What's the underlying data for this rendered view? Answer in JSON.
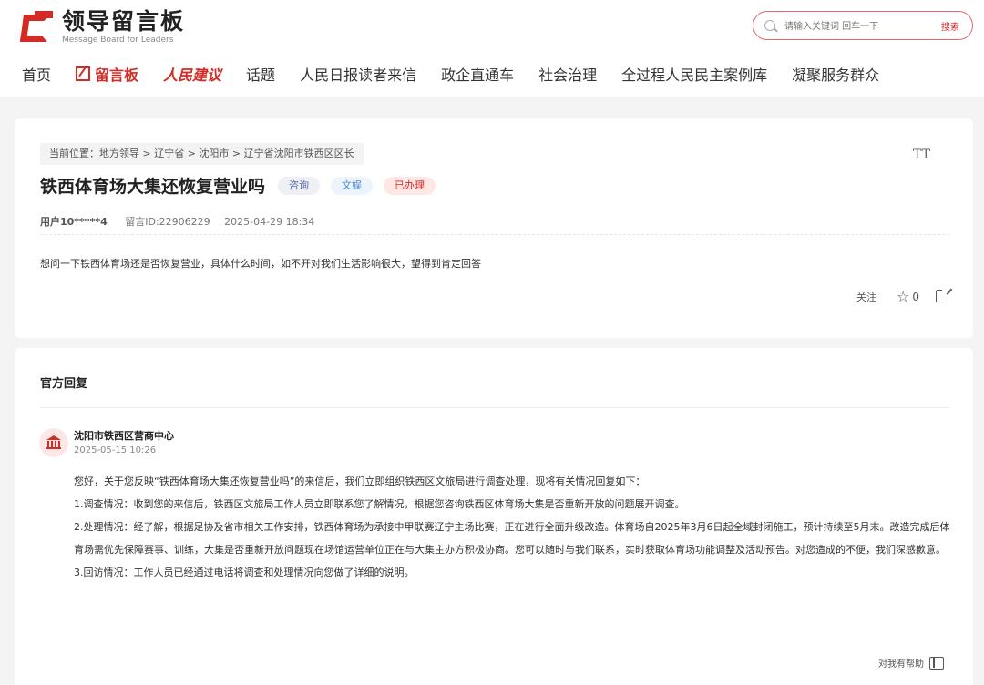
{
  "header": {
    "logo_title": "领导留言板",
    "logo_subtitle": "Message Board for Leaders",
    "search": {
      "placeholder": "请输入关键词 回车一下",
      "button": "搜索"
    }
  },
  "nav": [
    {
      "label": "首页"
    },
    {
      "label": "留言板"
    },
    {
      "label": "人民建议"
    },
    {
      "label": "话题"
    },
    {
      "label": "人民日报读者来信"
    },
    {
      "label": "政企直通车"
    },
    {
      "label": "社会治理"
    },
    {
      "label": "全过程人民民主案例库"
    },
    {
      "label": "凝聚服务群众"
    }
  ],
  "message": {
    "breadcrumb": "当前位置：地方领导 > 辽宁省 > 沈阳市 > 辽宁省沈阳市铁西区区长",
    "font_toggle": "TT",
    "title": "铁西体育场大集还恢复营业吗",
    "tags": [
      "咨询",
      "文娱",
      "已办理"
    ],
    "user": "用户10*****4",
    "message_id": "留言ID:22906229",
    "date": "2025-04-29 18:34",
    "content": "想问一下铁西体育场还是否恢复营业，具体什么时间，如不开对我们生活影响很大，望得到肯定回答",
    "follow_label": "关注",
    "star_count": "0"
  },
  "reply": {
    "heading": "官方回复",
    "org_name": "沈阳市铁西区营商中心",
    "time": "2025-05-15 10:26",
    "paragraphs": [
      "您好，关于您反映“铁西体育场大集还恢复营业吗”的来信后，我们立即组织铁西区文旅局进行调查处理，现将有关情况回复如下：",
      "1.调查情况：收到您的来信后，铁西区文旅局工作人员立即联系您了解情况，根据您咨询铁西区体育场大集是否重新开放的问题展开调查。",
      "2.处理情况：经了解，根据足协及省市相关工作安排，铁西体育场为承接中甲联赛辽宁主场比赛，正在进行全面升级改造。体育场自2025年3月6日起全域封闭施工，预计持续至5月末。改造完成后体育场需优先保障赛事、训练，大集是否重新开放问题现在场馆运营单位正在与大集主办方积极协商。您可以随时与我们联系，实时获取体育场功能调整及活动预告。对您造成的不便，我们深感歉意。",
      "3.回访情况：工作人员已经通过电话将调查和处理情况向您做了详细的说明。"
    ],
    "helpful_label": "对我有帮助"
  }
}
